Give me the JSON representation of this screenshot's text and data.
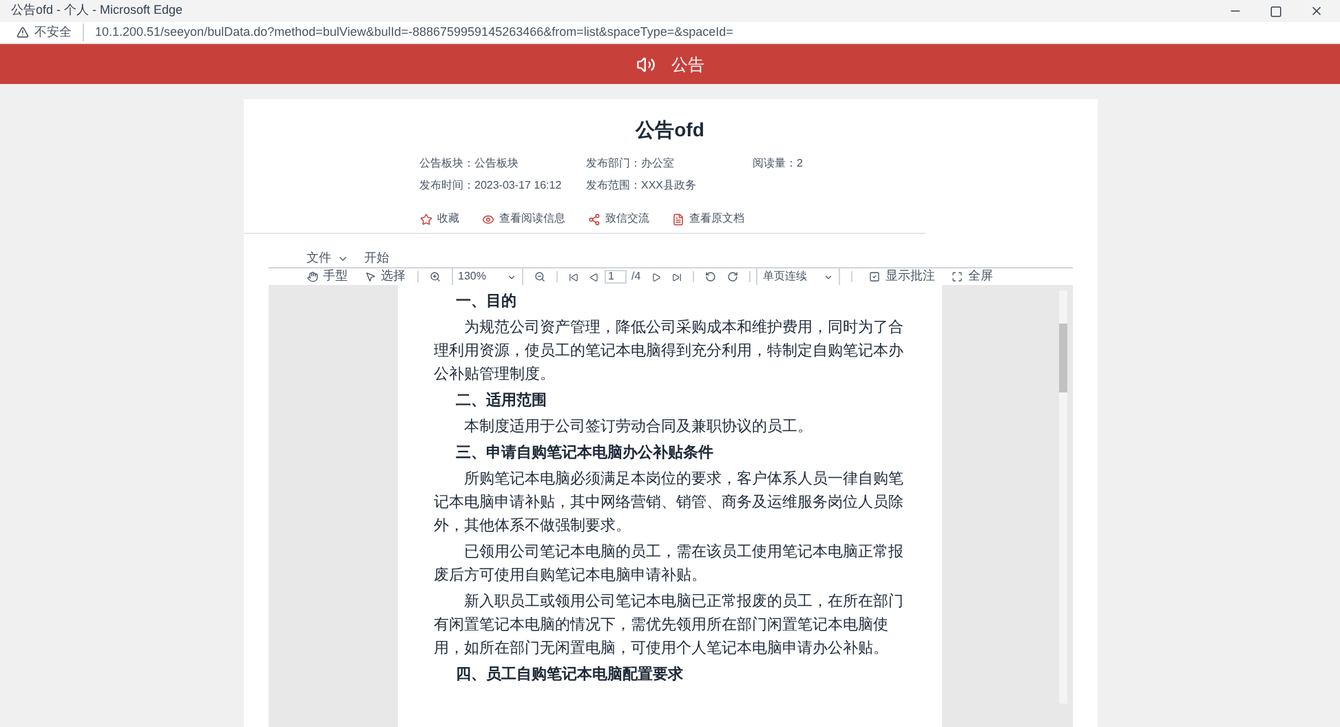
{
  "window": {
    "title": "公告ofd - 个人 - Microsoft Edge"
  },
  "address_bar": {
    "security": "不安全",
    "url": "10.1.200.51/seeyon/bulData.do?method=bulView&bulId=-8886759959145263466&from=list&spaceType=&spaceId="
  },
  "header": {
    "title": "公告"
  },
  "bulletin": {
    "title": "公告ofd",
    "meta": [
      {
        "label": "公告板块：公告板块"
      },
      {
        "label": "发布部门：办公室"
      },
      {
        "label": "阅读量：2"
      },
      {
        "label": "发布时间：2023-03-17 16:12"
      },
      {
        "label": "发布范围：XXX县政务"
      }
    ],
    "actions": [
      {
        "kind": "star",
        "label": "收藏"
      },
      {
        "kind": "eye",
        "label": "查看阅读信息"
      },
      {
        "kind": "share",
        "label": "致信交流"
      },
      {
        "kind": "doc",
        "label": "查看原文档"
      }
    ]
  },
  "viewer": {
    "menus": [
      "文件",
      "开始"
    ],
    "toolbar": {
      "hand": "手型",
      "select": "选择",
      "zoom": "130%",
      "page": "1",
      "pages": "/4",
      "view_mode": "单页连续",
      "annotations": "显示批注",
      "fullscreen": "全屏"
    },
    "document": [
      {
        "kind": "heading",
        "text": "一、目的"
      },
      {
        "kind": "para",
        "text": "为规范公司资产管理，降低公司采购成本和维护费用，同时为了合理利用资源，使员工的笔记本电脑得到充分利用，特制定自购笔记本办公补贴管理制度。"
      },
      {
        "kind": "heading",
        "text": "二、适用范围"
      },
      {
        "kind": "para",
        "text": "本制度适用于公司签订劳动合同及兼职协议的员工。"
      },
      {
        "kind": "heading",
        "text": "三、申请自购笔记本电脑办公补贴条件"
      },
      {
        "kind": "para",
        "text": "所购笔记本电脑必须满足本岗位的要求，客户体系人员一律自购笔记本电脑申请补贴，其中网络营销、销管、商务及运维服务岗位人员除外，其他体系不做强制要求。"
      },
      {
        "kind": "para",
        "text": "已领用公司笔记本电脑的员工，需在该员工使用笔记本电脑正常报废后方可使用自购笔记本电脑申请补贴。"
      },
      {
        "kind": "para",
        "text": "新入职员工或领用公司笔记本电脑已正常报废的员工，在所在部门有闲置笔记本电脑的情况下，需优先领用所在部门闲置笔记本电脑使用，如所在部门无闲置电脑，可使用个人笔记本电脑申请办公补贴。"
      },
      {
        "kind": "heading",
        "text": "四、员工自购笔记本电脑配置要求"
      }
    ]
  }
}
